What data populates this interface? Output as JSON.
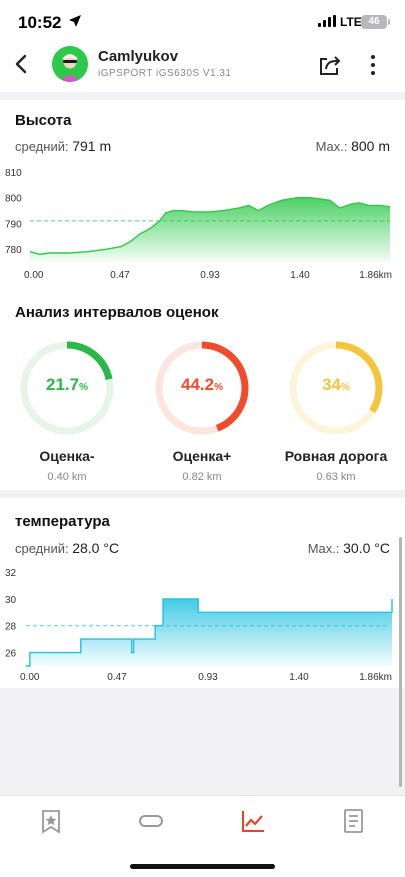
{
  "status": {
    "time": "10:52",
    "network": "LTE",
    "battery": "46"
  },
  "header": {
    "name": "Camlyukov",
    "device": "iGPSPORT iGS630S V1.31"
  },
  "altitude": {
    "title": "Высота",
    "avg_label": "средний:",
    "avg_value": "791 m",
    "max_label": "Max.:",
    "max_value": "800 m",
    "y_ticks": [
      "810",
      "800",
      "790",
      "780"
    ],
    "x_ticks": [
      "0.00",
      "0.47",
      "0.93",
      "1.40",
      "1.86km"
    ],
    "color": "#2ec84a"
  },
  "intervals": {
    "title": "Анализ интервалов оценок",
    "items": [
      {
        "value": "21.7",
        "unit": "%",
        "fraction": 0.217,
        "label": "Оценка-",
        "distance": "0.40 km",
        "color": "#2bb749",
        "track": "#e6f5e8"
      },
      {
        "value": "44.2",
        "unit": "%",
        "fraction": 0.442,
        "label": "Оценка+",
        "distance": "0.82 km",
        "color": "#f04c2c",
        "track": "#fde4df"
      },
      {
        "value": "34",
        "unit": "%",
        "fraction": 0.34,
        "label": "Ровная дорога",
        "distance": "0.63 km",
        "color": "#f4c43c",
        "track": "#fdf4dc"
      }
    ]
  },
  "temperature": {
    "title": "температура",
    "avg_label": "средний:",
    "avg_value": "28.0 °C",
    "max_label": "Max.:",
    "max_value": "30.0 °C",
    "y_ticks": [
      "32",
      "30",
      "28",
      "26"
    ],
    "x_ticks": [
      "0.00",
      "0.47",
      "0.93",
      "1.40",
      "1.86km"
    ],
    "color": "#22c3e0"
  },
  "chart_data": [
    {
      "type": "area",
      "title": "Высота",
      "xlabel": "km",
      "ylabel": "m",
      "ylim": [
        775,
        810
      ],
      "xlim": [
        0,
        1.86
      ],
      "avg": 791,
      "x": [
        0.0,
        0.05,
        0.1,
        0.2,
        0.3,
        0.4,
        0.47,
        0.52,
        0.57,
        0.62,
        0.67,
        0.7,
        0.74,
        0.78,
        0.85,
        0.93,
        1.0,
        1.08,
        1.13,
        1.18,
        1.23,
        1.3,
        1.38,
        1.45,
        1.55,
        1.6,
        1.66,
        1.7,
        1.75,
        1.8,
        1.86
      ],
      "values": [
        779,
        778,
        778.5,
        778.5,
        779,
        780,
        781,
        783,
        786,
        788,
        791,
        794,
        795,
        795,
        794.5,
        794.5,
        795,
        796,
        797,
        795,
        797,
        799,
        800,
        800,
        799,
        796,
        797.5,
        798,
        797,
        797,
        796.5
      ]
    },
    {
      "type": "area",
      "title": "температура",
      "xlabel": "km",
      "ylabel": "°C",
      "ylim": [
        25,
        32
      ],
      "xlim": [
        0,
        1.86
      ],
      "avg": 28.0,
      "step": true,
      "x": [
        0.0,
        0.02,
        0.28,
        0.54,
        0.55,
        0.58,
        0.66,
        0.7,
        0.88,
        1.86,
        1.87
      ],
      "values": [
        25,
        26,
        27,
        26,
        27,
        27,
        28,
        30,
        29,
        29,
        30
      ]
    }
  ]
}
